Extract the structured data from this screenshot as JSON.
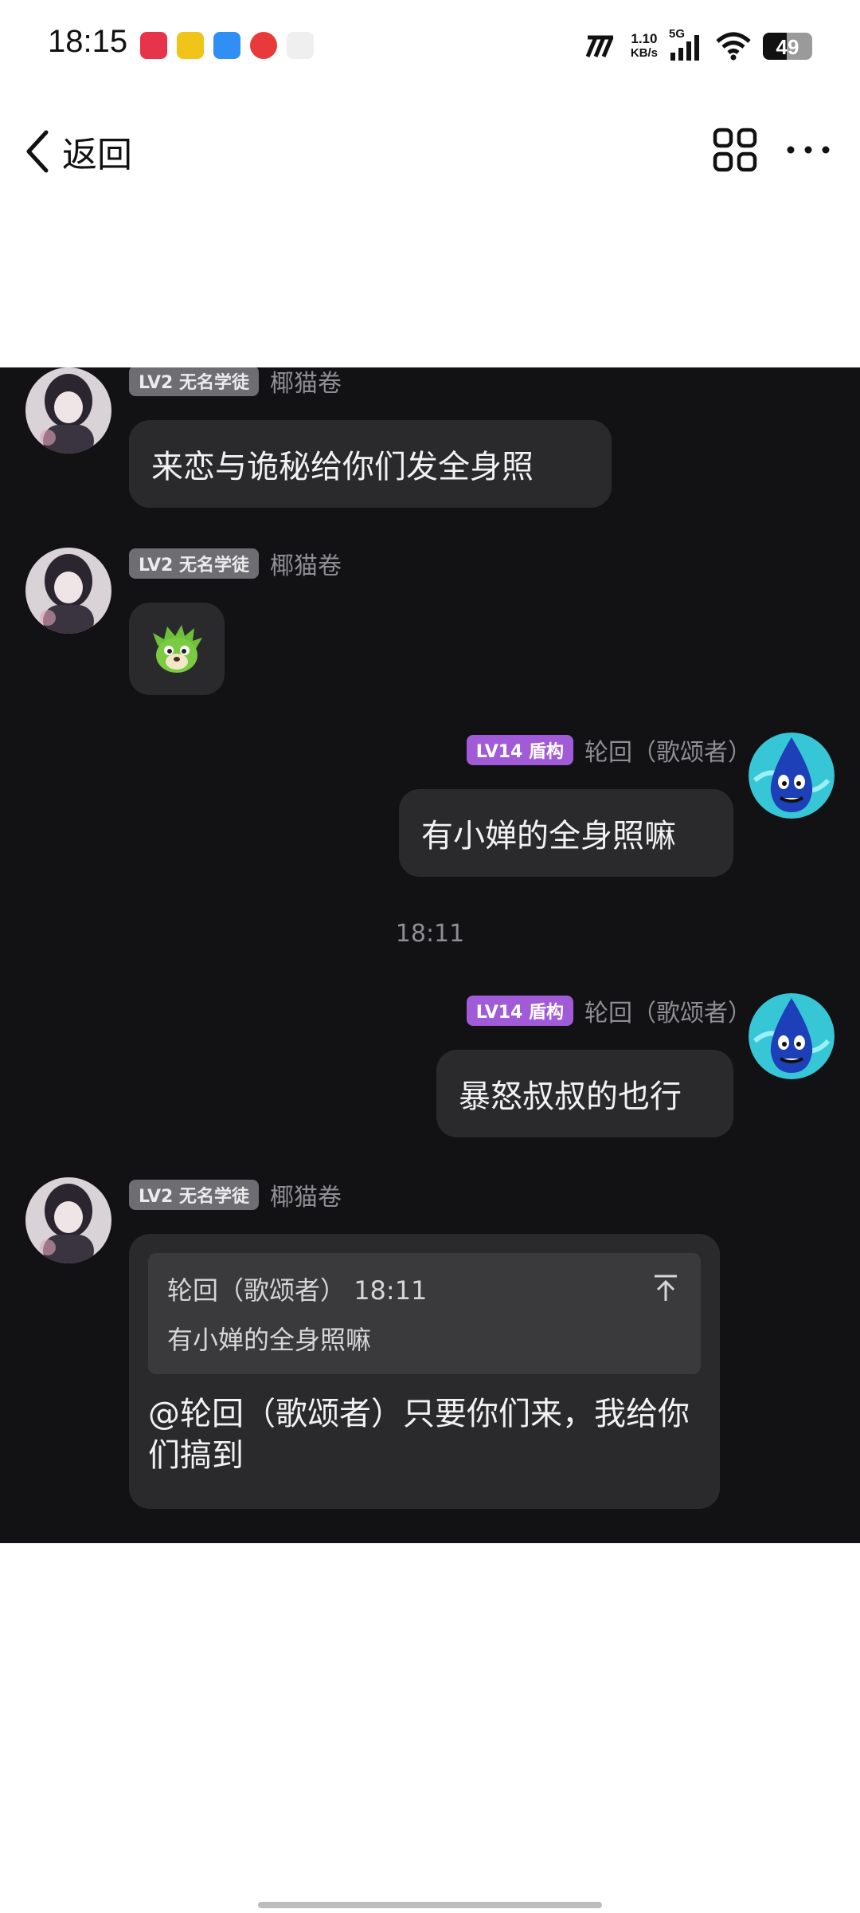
{
  "status_bar": {
    "time": "18:15",
    "network_speed_value": "1.10",
    "network_speed_unit": "KB/s",
    "network_type": "5G",
    "battery_level": "49",
    "app_icons": [
      "xiaohongshu-icon",
      "game-app-icon",
      "browser-app-icon",
      "netease-music-icon",
      "tiktok-icon"
    ]
  },
  "nav": {
    "back_label": "返回",
    "grid_icon": "grid-icon",
    "more_icon": "more-icon"
  },
  "chat": {
    "messages": [
      {
        "side": "left",
        "level": "LV2 无名学徒",
        "name": "椰猫卷",
        "text": "来恋与诡秘给你们发全身照"
      },
      {
        "side": "left",
        "level": "LV2 无名学徒",
        "name": "椰猫卷",
        "sticker": "green-monster-sticker"
      },
      {
        "side": "right",
        "level": "LV14 盾构",
        "name": "轮回（歌颂者）",
        "text": "有小婵的全身照嘛"
      },
      {
        "side": "right",
        "level": "LV14 盾构",
        "name": "轮回（歌颂者）",
        "text": "暴怒叔叔的也行"
      },
      {
        "side": "left",
        "level": "LV2 无名学徒",
        "name": "椰猫卷",
        "quote": {
          "author": "轮回（歌颂者）",
          "time": "18:11",
          "text": "有小婵的全身照嘛"
        },
        "text": "@轮回（歌颂者）只要你们来，我给你们搞到"
      }
    ],
    "timestamp": "18:11"
  },
  "colors": {
    "chat_background": "#121214",
    "bubble": "#2a2a2d",
    "badge_gray": "#6d6d72",
    "badge_purple": "#a15bd8"
  }
}
